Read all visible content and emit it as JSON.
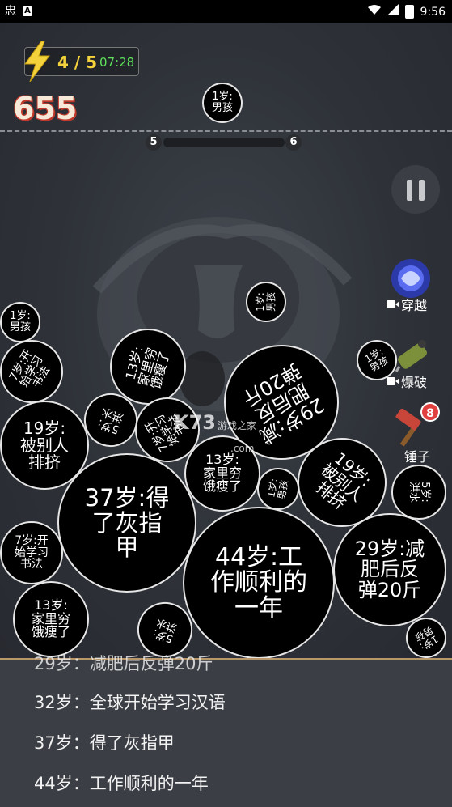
{
  "status_bar": {
    "left_icons": [
      "app-icon-1",
      "a-notification-icon"
    ],
    "time": "9:56"
  },
  "hud": {
    "energy_count": "4 / 5",
    "energy_timer": "07:28",
    "score": "655",
    "level_current": "5",
    "level_next": "6",
    "level_progress": 0.0
  },
  "tools": [
    {
      "name": "warp",
      "label": "穿越",
      "icon": "portal-icon",
      "video": true
    },
    {
      "name": "bomb",
      "label": "爆破",
      "icon": "bomb-icon",
      "video": true
    },
    {
      "name": "hammer",
      "label": "锤子",
      "icon": "hammer-icon",
      "count": "8"
    }
  ],
  "balls": [
    {
      "id": "b1",
      "text": "1岁:\n男孩",
      "rot": 0
    },
    {
      "id": "b2",
      "text": "1岁:\n男孩",
      "rot": 0
    },
    {
      "id": "b3",
      "text": "1岁:\n男孩",
      "rot": 0
    },
    {
      "id": "b4",
      "text": "7岁:开\n始学习\n书法",
      "rot": 0
    },
    {
      "id": "b5",
      "text": "13岁:\n家里穷\n饿瘦了",
      "rot": 0
    },
    {
      "id": "b6",
      "text": "1岁:\n男孩",
      "rot": 0
    },
    {
      "id": "b7",
      "text": "29岁:减\n肥后反\n弹20斤",
      "rot": 0
    },
    {
      "id": "b8",
      "text": "19岁:\n被别人\n排挤",
      "rot": 0
    },
    {
      "id": "b9",
      "text": "5岁:\n洪水",
      "rot": 0
    },
    {
      "id": "b10",
      "text": "7岁:开\n始学习\n书法",
      "rot": 0
    },
    {
      "id": "b11",
      "text": "13岁:\n家里穷\n饿瘦了",
      "rot": 0
    },
    {
      "id": "b12",
      "text": "1岁:\n男孩",
      "rot": 0
    },
    {
      "id": "b13",
      "text": "19岁:\n被别人\n排挤",
      "rot": 0
    },
    {
      "id": "b14",
      "text": "5岁:\n洪水",
      "rot": 0
    },
    {
      "id": "b15",
      "text": "37岁:得\n了灰指\n甲",
      "rot": 0
    },
    {
      "id": "b16",
      "text": "44岁:工\n作顺利的\n一年",
      "rot": 0
    },
    {
      "id": "b17",
      "text": "29岁:减\n肥后反\n弹20斤",
      "rot": 0
    },
    {
      "id": "b18",
      "text": "7岁:开\n始学习\n书法",
      "rot": 0
    },
    {
      "id": "b19",
      "text": "13岁:\n家里穷\n饿瘦了",
      "rot": 0
    },
    {
      "id": "b20",
      "text": "5岁:\n洪水",
      "rot": 0
    },
    {
      "id": "b21",
      "text": "1岁:\n男孩",
      "rot": 0
    }
  ],
  "watermark": {
    "brand": "K73",
    "sub": "游戏之家",
    "domain": ".com"
  },
  "history": {
    "partial": "29岁：减肥后反弹20斤",
    "items": [
      "32岁：全球开始学习汉语",
      "37岁：得了灰指甲",
      "44岁：工作顺利的一年"
    ]
  },
  "colors": {
    "score_fill": "#f7e9d8",
    "score_outline": "#c0392b",
    "energy_count": "#f4d23c",
    "energy_timer": "#5ee05b",
    "history_border": "#b99769"
  }
}
